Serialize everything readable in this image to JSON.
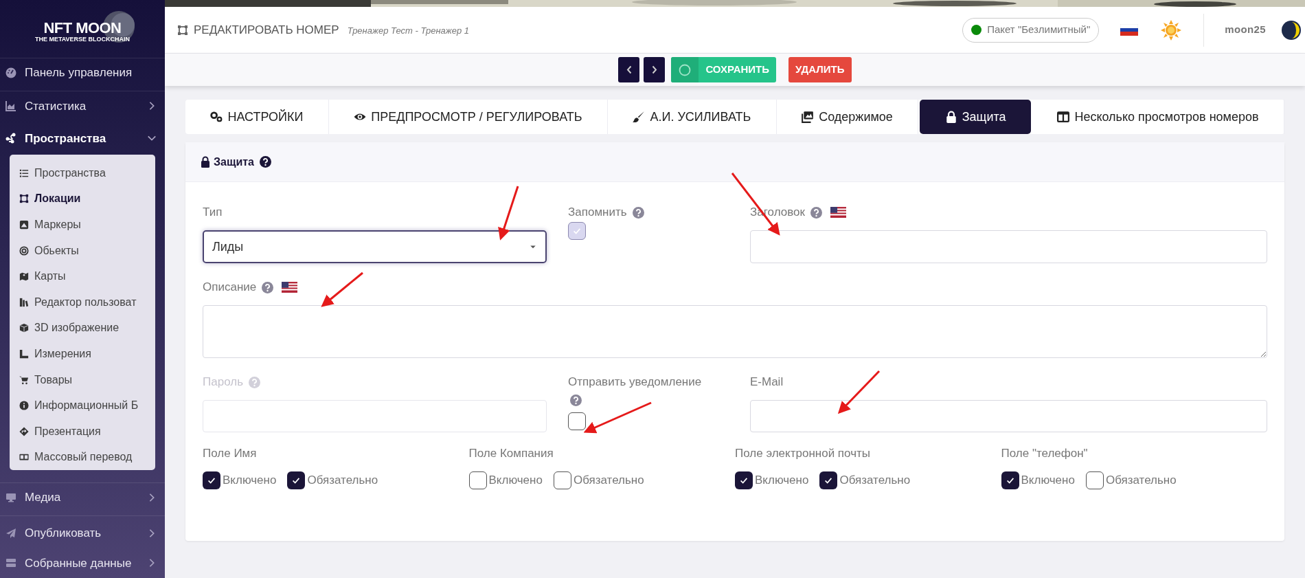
{
  "logo": {
    "title": "NFT MOON",
    "subtitle": "THE METAVERSE BLOCKCHAIN"
  },
  "sidebar": {
    "items": [
      {
        "label": "Панель управления",
        "expanded": false
      },
      {
        "label": "Статистика",
        "expanded": false
      },
      {
        "label": "Пространства",
        "expanded": true,
        "children": [
          {
            "label": "Пространства",
            "selected": false
          },
          {
            "label": "Локации",
            "selected": true
          },
          {
            "label": "Маркеры",
            "selected": false
          },
          {
            "label": "Обьекты",
            "selected": false
          },
          {
            "label": "Карты",
            "selected": false
          },
          {
            "label": "Редактор пользоват",
            "selected": false
          },
          {
            "label": "3D изображение",
            "selected": false
          },
          {
            "label": "Измерения",
            "selected": false
          },
          {
            "label": "Товары",
            "selected": false
          },
          {
            "label": "Информационный Б",
            "selected": false
          },
          {
            "label": "Презентация",
            "selected": false
          },
          {
            "label": "Массовый перевод",
            "selected": false
          }
        ]
      },
      {
        "label": "Медиа",
        "expanded": false
      },
      {
        "label": "Опубликовать",
        "expanded": false
      },
      {
        "label": "Собранные данные",
        "expanded": false
      }
    ]
  },
  "header": {
    "title": "РЕДАКТИРОВАТЬ НОМЕР",
    "subtitle": "Тренажер Тест - Тренажер 1",
    "plan": "Пакет \"Безлимитный\"",
    "username": "moon25"
  },
  "toolbar": {
    "save": "СОХРАНИТЬ",
    "delete": "УДАЛИТЬ"
  },
  "tabs": [
    {
      "label": "НАСТРОЙКИ",
      "selected": false
    },
    {
      "label": "ПРЕДПРОСМОТР / РЕГУЛИРОВАТЬ",
      "selected": false
    },
    {
      "label": "А.И. УСИЛИВАТЬ",
      "selected": false
    },
    {
      "label": "Содержимое",
      "selected": false
    },
    {
      "label": "Защита",
      "selected": true
    },
    {
      "label": "Несколько просмотров номеров",
      "selected": false
    }
  ],
  "panel": {
    "title": "Защита",
    "type": {
      "label": "Тип",
      "value": "Лиды"
    },
    "remember": {
      "label": "Запомнить",
      "checked": true,
      "disabled": true
    },
    "heading": {
      "label": "Заголовок"
    },
    "description": {
      "label": "Описание"
    },
    "password": {
      "label": "Пароль",
      "disabled": true
    },
    "notify": {
      "label": "Отправить уведомление",
      "checked": false
    },
    "email": {
      "label": "E-Mail"
    },
    "field_groups": [
      {
        "label": "Поле Имя",
        "options": [
          {
            "label": "Включено",
            "checked": true
          },
          {
            "label": "Обязательно",
            "checked": true
          }
        ]
      },
      {
        "label": "Поле Компания",
        "options": [
          {
            "label": "Включено",
            "checked": false
          },
          {
            "label": "Обязательно",
            "checked": false
          }
        ]
      },
      {
        "label": "Поле электронной почты",
        "options": [
          {
            "label": "Включено",
            "checked": true
          },
          {
            "label": "Обязательно",
            "checked": true
          }
        ]
      },
      {
        "label": "Поле \"телефон\"",
        "options": [
          {
            "label": "Включено",
            "checked": true
          },
          {
            "label": "Обязательно",
            "checked": false
          }
        ]
      }
    ]
  }
}
